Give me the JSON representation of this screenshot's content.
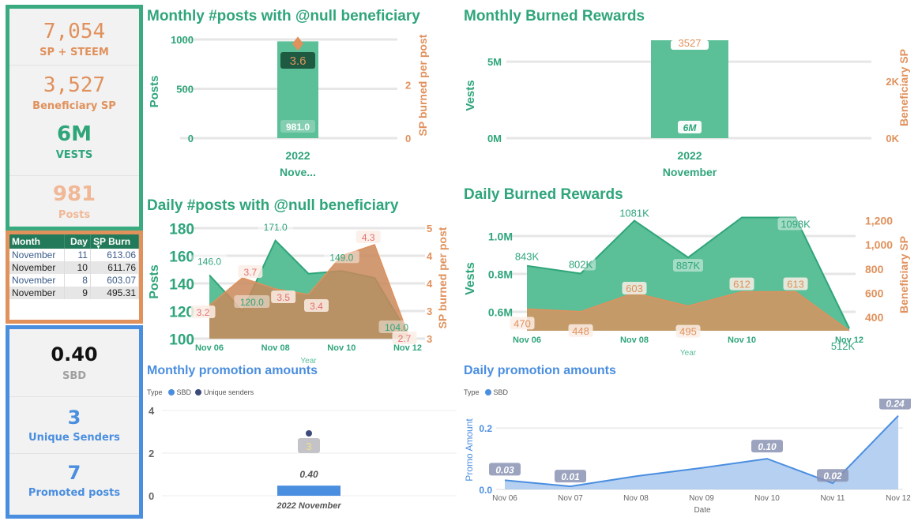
{
  "kpis_burn": [
    {
      "value": "7,054",
      "label": "SP + STEEM",
      "color": "#e0915c"
    },
    {
      "value": "3,527",
      "label": "Beneficiary SP",
      "color": "#e0915c"
    },
    {
      "value": "6M",
      "label": "VESTS",
      "color": "#2fa57a"
    },
    {
      "value": "981",
      "label": "Posts",
      "color": "#f0b896"
    }
  ],
  "table": {
    "headers": [
      "Month",
      "Day",
      "SP Burn"
    ],
    "sort_column": "SP Burn",
    "rows": [
      [
        "November",
        "11",
        "613.06"
      ],
      [
        "November",
        "10",
        "611.76"
      ],
      [
        "November",
        "8",
        "603.07"
      ],
      [
        "November",
        "9",
        "495.31"
      ]
    ]
  },
  "kpis_promo": [
    {
      "value": "0.40",
      "label": "SBD",
      "value_color": "#111111",
      "label_color": "#a0a0a0"
    },
    {
      "value": "3",
      "label": "Unique Senders",
      "value_color": "#4a8ee0",
      "label_color": "#4a8ee0"
    },
    {
      "value": "7",
      "label": "Promoted posts",
      "value_color": "#4a8ee0",
      "label_color": "#4a8ee0"
    }
  ],
  "colors": {
    "green": "#2fa57a",
    "green_fill": "#5bbf98",
    "orange": "#e0915c",
    "orange_fill": "#c49a68",
    "blue": "#4a8ee0",
    "navy": "#3b4a7a"
  },
  "chart_data": [
    {
      "id": "monthly_posts",
      "type": "bar",
      "title": "Monthly #posts with @null beneficiary",
      "categories": [
        "2022",
        "Nove..."
      ],
      "category_label": [
        "2022",
        "Nove..."
      ],
      "series": [
        {
          "name": "Posts",
          "axis": "left",
          "values": [
            981.0
          ],
          "label": "981.0"
        },
        {
          "name": "SP burned per post",
          "axis": "right",
          "values": [
            3.6
          ],
          "label": "3.6",
          "marker": "diamond"
        }
      ],
      "ylabel": "Posts",
      "y2label": "SP burned per post",
      "yticks": [
        "0",
        "500",
        "1000"
      ],
      "y2ticks": [
        "0",
        "2"
      ],
      "ylim": [
        0,
        1000
      ],
      "y2lim": [
        0,
        3.7
      ]
    },
    {
      "id": "monthly_burned",
      "type": "bar",
      "title": "Monthly Burned Rewards",
      "category_label": [
        "2022",
        "November"
      ],
      "series": [
        {
          "name": "Vests",
          "axis": "left",
          "values": [
            6400000
          ],
          "label": "6M"
        },
        {
          "name": "Beneficiary SP",
          "axis": "right",
          "values": [
            3527
          ],
          "label": "3527"
        }
      ],
      "ylabel": "Vests",
      "y2label": "Beneficiary SP",
      "yticks": [
        "0M",
        "5M"
      ],
      "y2ticks": [
        "0K",
        "2K"
      ],
      "ylim": [
        0,
        6400000
      ],
      "y2lim": [
        0,
        3527
      ]
    },
    {
      "id": "daily_posts",
      "type": "area",
      "title": "Daily #posts with @null beneficiary",
      "x": [
        "Nov 06",
        "Nov 07",
        "Nov 08",
        "Nov 09",
        "Nov 10",
        "Nov 11",
        "Nov 12"
      ],
      "xticks": [
        "Nov 06",
        "Nov 08",
        "Nov 10",
        "Nov 12"
      ],
      "xlabel": "Year",
      "series": [
        {
          "name": "Posts",
          "axis": "left",
          "values": [
            146,
            120,
            171,
            147,
            149,
            144,
            104
          ],
          "labels": [
            "146.0",
            "120.0",
            "171.0",
            "",
            "149.0",
            "",
            "104.0"
          ]
        },
        {
          "name": "SP burned per post",
          "axis": "right",
          "values": [
            3.2,
            3.7,
            3.5,
            3.4,
            4.1,
            4.3,
            2.7
          ],
          "labels": [
            "3.2",
            "3.7",
            "3.5",
            "3.4",
            "",
            "4.3",
            "2.7"
          ]
        }
      ],
      "ylabel": "Posts",
      "y2label": "SP burned per post",
      "yticks": [
        "100",
        "120",
        "140",
        "160",
        "180"
      ],
      "y2ticks": [
        "3",
        "3",
        "4",
        "4",
        "5"
      ],
      "ylim": [
        100,
        180
      ],
      "y2lim": [
        2.6,
        4.6
      ]
    },
    {
      "id": "daily_burned",
      "type": "area",
      "title": "Daily Burned Rewards",
      "x": [
        "Nov 06",
        "Nov 07",
        "Nov 08",
        "Nov 09",
        "Nov 10",
        "Nov 11",
        "Nov 12"
      ],
      "xticks": [
        "Nov 06",
        "Nov 08",
        "Nov 10",
        "Nov 12"
      ],
      "xlabel": "Year",
      "series": [
        {
          "name": "Vests",
          "axis": "left",
          "values": [
            843000,
            802000,
            1081000,
            887000,
            1098000,
            1098000,
            512000
          ],
          "labels": [
            "843K",
            "802K",
            "1081K",
            "887K",
            "",
            "1098K",
            "512K"
          ]
        },
        {
          "name": "Beneficiary SP",
          "axis": "right",
          "values": [
            470,
            448,
            603,
            495,
            612,
            613,
            290
          ],
          "labels": [
            "470",
            "448",
            "603",
            "495",
            "612",
            "613",
            ""
          ]
        }
      ],
      "ylabel": "Vests",
      "y2label": "Beneficiary SP",
      "yticks": [
        "0.6M",
        "0.8M",
        "1.0M"
      ],
      "y2ticks": [
        "400",
        "600",
        "800",
        "1,000",
        "1,200"
      ],
      "ylim": [
        500000,
        1100000
      ],
      "y2lim": [
        290,
        1230
      ]
    },
    {
      "id": "monthly_promo",
      "type": "bar",
      "title": "Monthly promotion amounts",
      "legend_title": "Type",
      "legend": [
        "SBD",
        "Unique senders"
      ],
      "categories": [
        "2022 November"
      ],
      "series": [
        {
          "name": "SBD",
          "values": [
            0.4
          ],
          "label": "0.40"
        },
        {
          "name": "Unique senders",
          "values": [
            3
          ],
          "label": "3",
          "marker": "dot"
        }
      ],
      "yticks": [
        "0",
        "2",
        "4"
      ],
      "ylim": [
        0,
        4
      ]
    },
    {
      "id": "daily_promo",
      "type": "area",
      "title": "Daily promotion amounts",
      "legend_title": "Type",
      "legend": [
        "SBD"
      ],
      "x": [
        "Nov 06",
        "Nov 07",
        "Nov 08",
        "Nov 09",
        "Nov 10",
        "Nov 11",
        "Nov 12"
      ],
      "series": [
        {
          "name": "SBD",
          "values": [
            0.03,
            0.01,
            0.043,
            0.07,
            0.1,
            0.02,
            0.24
          ],
          "labels": [
            "0.03",
            "0.01",
            "",
            "",
            "0.10",
            "0.02",
            "0.24"
          ]
        }
      ],
      "xlabel": "Date",
      "ylabel": "Promo Amount",
      "yticks": [
        "0.0",
        "0.2"
      ],
      "ylim": [
        0,
        0.27
      ]
    }
  ]
}
